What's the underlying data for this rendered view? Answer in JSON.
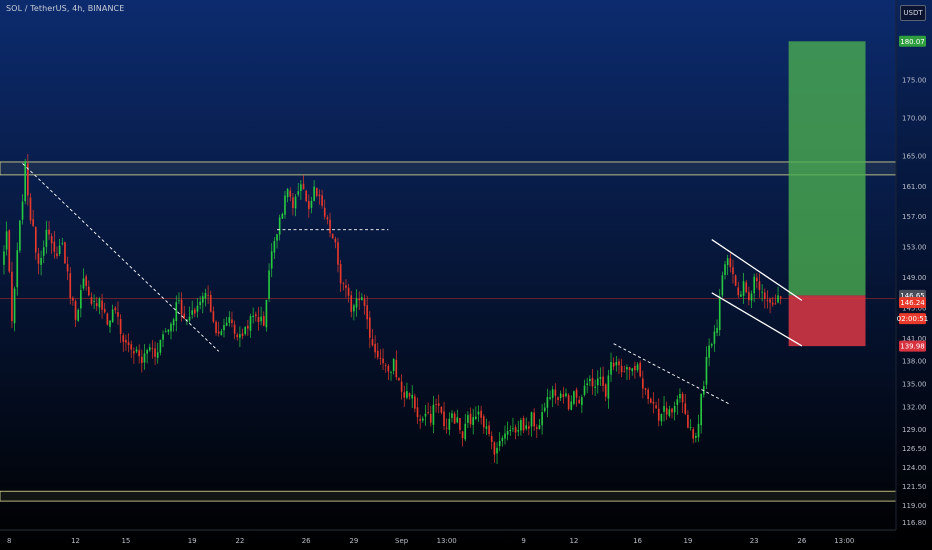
{
  "header": {
    "title": "SOL / TetherUS, 4h, BINANCE",
    "currency": "USDT"
  },
  "colors": {
    "background_top": "#0c2b6e",
    "background_bottom": "#000000",
    "candle_up": "#26c93f",
    "candle_down": "#e8392b",
    "zone_line": "#e0e090",
    "trend_line": "#ffffff",
    "target_zone": "#4caf50",
    "stop_zone": "#e53945",
    "target_tag": "#2e9e3f",
    "stop_tag": "#d6323f",
    "price_tag": "#e8392b",
    "close_tag": "#4a4e5a"
  },
  "chart_data": {
    "type": "candlestick",
    "symbol": "SOL / TetherUS",
    "interval": "4h",
    "exchange": "BINANCE",
    "ylim": [
      115.8,
      185.5
    ],
    "y_ticks": [
      116.8,
      119.0,
      121.5,
      124.0,
      126.5,
      129.0,
      132.0,
      135.0,
      138.0,
      141.0,
      145.0,
      149.0,
      153.0,
      157.0,
      161.0,
      165.0,
      170.0,
      175.0
    ],
    "y_tick_labels": [
      "116.80",
      "119.00",
      "121.50",
      "124.00",
      "126.50",
      "129.00",
      "132.00",
      "135.00",
      "138.00",
      "141.00",
      "145.00",
      "149.00",
      "153.00",
      "157.00",
      "161.00",
      "165.00",
      "170.00",
      "175.00"
    ],
    "x_ticks": [
      {
        "label": "8",
        "bar": 3
      },
      {
        "label": "12",
        "bar": 28
      },
      {
        "label": "15",
        "bar": 47
      },
      {
        "label": "19",
        "bar": 72
      },
      {
        "label": "22",
        "bar": 90
      },
      {
        "label": "26",
        "bar": 115
      },
      {
        "label": "29",
        "bar": 133
      },
      {
        "label": "Sep",
        "bar": 151
      },
      {
        "label": "13:00",
        "bar": 168
      },
      {
        "label": "9",
        "bar": 197
      },
      {
        "label": "12",
        "bar": 216
      },
      {
        "label": "16",
        "bar": 240
      },
      {
        "label": "19",
        "bar": 259
      },
      {
        "label": "23",
        "bar": 284
      },
      {
        "label": "26",
        "bar": 302
      },
      {
        "label": "13:00",
        "bar": 318
      }
    ],
    "bar_count": 338,
    "last_bar": 294,
    "anchors": [
      [
        0,
        150.5
      ],
      [
        2,
        155.0
      ],
      [
        4,
        143.0
      ],
      [
        6,
        152.0
      ],
      [
        9,
        163.5
      ],
      [
        11,
        157.0
      ],
      [
        14,
        151.0
      ],
      [
        17,
        155.0
      ],
      [
        20,
        152.0
      ],
      [
        23,
        153.5
      ],
      [
        26,
        147.0
      ],
      [
        28,
        144.0
      ],
      [
        31,
        148.5
      ],
      [
        34,
        145.0
      ],
      [
        37,
        146.5
      ],
      [
        40,
        143.0
      ],
      [
        43,
        145.0
      ],
      [
        45,
        141.5
      ],
      [
        48,
        140.0
      ],
      [
        51,
        139.0
      ],
      [
        53,
        138.0
      ],
      [
        56,
        140.0
      ],
      [
        58,
        139.0
      ],
      [
        61,
        141.5
      ],
      [
        64,
        143.0
      ],
      [
        67,
        146.5
      ],
      [
        69,
        143.0
      ],
      [
        72,
        144.0
      ],
      [
        75,
        146.0
      ],
      [
        78,
        147.0
      ],
      [
        80,
        143.0
      ],
      [
        83,
        141.5
      ],
      [
        86,
        144.0
      ],
      [
        88,
        142.0
      ],
      [
        90,
        141.0
      ],
      [
        93,
        143.0
      ],
      [
        96,
        144.0
      ],
      [
        99,
        143.0
      ],
      [
        101,
        150.0
      ],
      [
        103,
        154.0
      ],
      [
        105,
        157.0
      ],
      [
        107,
        159.0
      ],
      [
        108,
        161.0
      ],
      [
        110,
        158.0
      ],
      [
        112,
        160.0
      ],
      [
        114,
        161.0
      ],
      [
        116,
        158.0
      ],
      [
        118,
        160.5
      ],
      [
        120,
        159.0
      ],
      [
        122,
        157.0
      ],
      [
        124,
        155.0
      ],
      [
        126,
        153.0
      ],
      [
        128,
        148.5
      ],
      [
        130,
        147.0
      ],
      [
        132,
        145.0
      ],
      [
        134,
        146.5
      ],
      [
        136,
        147.0
      ],
      [
        138,
        143.0
      ],
      [
        140,
        140.0
      ],
      [
        142,
        139.0
      ],
      [
        144,
        137.5
      ],
      [
        146,
        136.0
      ],
      [
        148,
        138.0
      ],
      [
        150,
        135.0
      ],
      [
        152,
        133.5
      ],
      [
        154,
        134.0
      ],
      [
        156,
        132.0
      ],
      [
        158,
        130.0
      ],
      [
        160,
        131.0
      ],
      [
        162,
        130.0
      ],
      [
        164,
        133.0
      ],
      [
        166,
        131.0
      ],
      [
        168,
        129.0
      ],
      [
        170,
        131.0
      ],
      [
        172,
        130.0
      ],
      [
        174,
        128.0
      ],
      [
        176,
        130.5
      ],
      [
        178,
        130.0
      ],
      [
        180,
        132.0
      ],
      [
        182,
        130.0
      ],
      [
        184,
        128.0
      ],
      [
        186,
        126.5
      ],
      [
        188,
        127.0
      ],
      [
        190,
        129.0
      ],
      [
        192,
        129.5
      ],
      [
        194,
        128.5
      ],
      [
        196,
        130.0
      ],
      [
        198,
        129.0
      ],
      [
        200,
        130.5
      ],
      [
        202,
        129.5
      ],
      [
        204,
        131.0
      ],
      [
        206,
        133.0
      ],
      [
        208,
        135.0
      ],
      [
        210,
        133.5
      ],
      [
        212,
        134.0
      ],
      [
        214,
        132.0
      ],
      [
        216,
        134.5
      ],
      [
        218,
        132.5
      ],
      [
        220,
        134.0
      ],
      [
        222,
        135.5
      ],
      [
        224,
        135.0
      ],
      [
        226,
        135.5
      ],
      [
        228,
        134.0
      ],
      [
        230,
        137.5
      ],
      [
        232,
        138.5
      ],
      [
        234,
        137.0
      ],
      [
        236,
        137.0
      ],
      [
        238,
        136.5
      ],
      [
        240,
        137.0
      ],
      [
        242,
        135.0
      ],
      [
        244,
        133.0
      ],
      [
        246,
        132.0
      ],
      [
        248,
        130.0
      ],
      [
        250,
        131.5
      ],
      [
        252,
        131.0
      ],
      [
        254,
        131.5
      ],
      [
        256,
        133.0
      ],
      [
        258,
        131.0
      ],
      [
        260,
        129.0
      ],
      [
        262,
        128.0
      ],
      [
        264,
        133.0
      ],
      [
        266,
        138.0
      ],
      [
        268,
        141.0
      ],
      [
        270,
        143.0
      ],
      [
        272,
        150.0
      ],
      [
        274,
        152.0
      ],
      [
        276,
        149.0
      ],
      [
        278,
        146.0
      ],
      [
        280,
        148.0
      ],
      [
        282,
        146.0
      ],
      [
        284,
        149.0
      ],
      [
        286,
        148.0
      ],
      [
        288,
        147.0
      ],
      [
        290,
        146.0
      ],
      [
        292,
        145.5
      ],
      [
        294,
        146.24
      ]
    ],
    "zones": [
      {
        "name": "resistance-zone",
        "y1": 162.5,
        "y2": 164.2
      },
      {
        "name": "support-zone",
        "y1": 119.6,
        "y2": 120.9
      }
    ],
    "levels": [
      {
        "name": "current-price-line",
        "y": 146.24
      }
    ],
    "trendlines": [
      {
        "name": "trendline-1",
        "from": [
          8,
          164.0
        ],
        "to": [
          82,
          139.3
        ],
        "dashed": true
      },
      {
        "name": "trendline-2",
        "from": [
          104,
          155.3
        ],
        "to": [
          146,
          155.3
        ],
        "dashed": true
      },
      {
        "name": "trendline-3",
        "from": [
          231,
          140.3
        ],
        "to": [
          275,
          132.3
        ],
        "dashed": true
      },
      {
        "name": "channel-upper",
        "from": [
          268,
          154.0
        ],
        "to": [
          302,
          146.0
        ],
        "dashed": false
      },
      {
        "name": "channel-lower",
        "from": [
          268,
          147.0
        ],
        "to": [
          302,
          140.0
        ],
        "dashed": false
      }
    ],
    "position": {
      "x_start": 297,
      "x_end": 326,
      "entry": 146.65,
      "target": 180.07,
      "stop": 139.98
    },
    "price_tags": [
      {
        "name": "target-price-tag",
        "label": "180.07",
        "y": 180.07,
        "role": "target_tag"
      },
      {
        "name": "entry-price-tag",
        "label": "146.65",
        "y": 146.65,
        "role": "close_tag"
      },
      {
        "name": "last-price-tag",
        "label": "146.24",
        "y": 145.7,
        "role": "price_tag"
      },
      {
        "name": "countdown-tag",
        "label": "02:00:51",
        "y": 143.6,
        "role": "price_tag"
      },
      {
        "name": "stop-price-tag",
        "label": "139.98",
        "y": 139.98,
        "role": "stop_tag"
      }
    ]
  }
}
